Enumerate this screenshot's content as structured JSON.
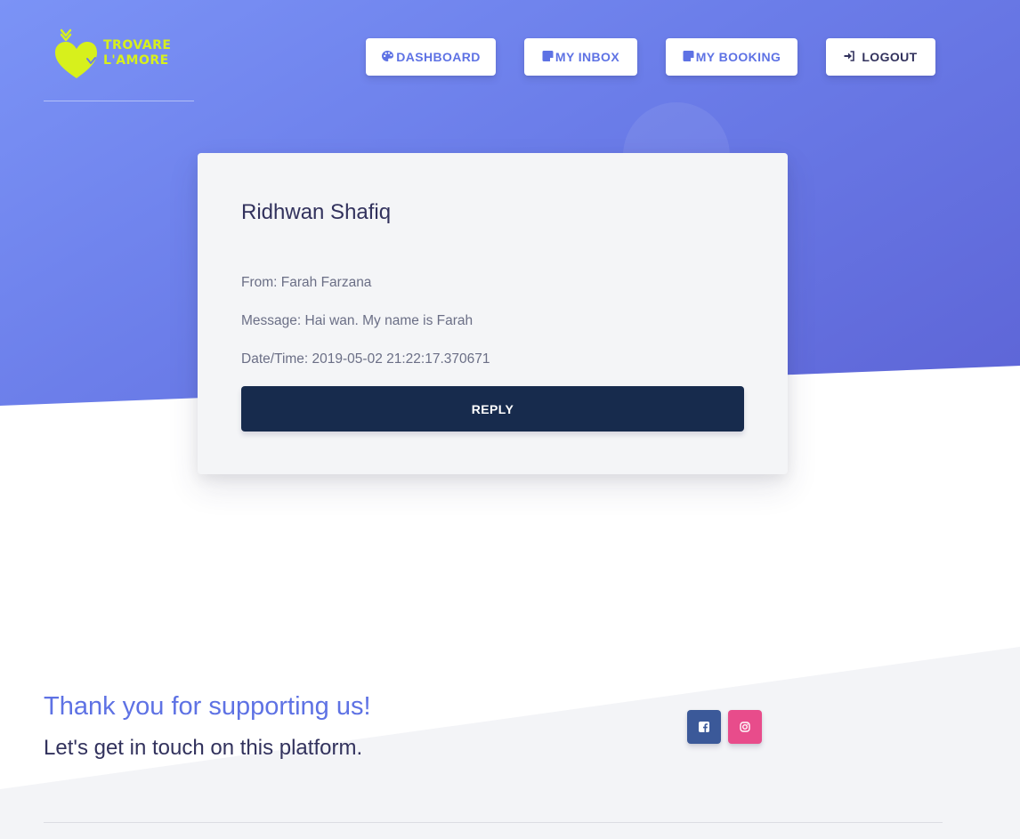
{
  "brand": {
    "logo_line1": "TROVARE",
    "logo_line2": "L'AMORE",
    "logo_color": "#d7f01c",
    "icon": "heart-logo-icon"
  },
  "nav": {
    "items": [
      {
        "label": "DASHBOARD",
        "icon": "palette-icon"
      },
      {
        "label": "MY INBOX",
        "icon": "inbox-icon"
      },
      {
        "label": "MY BOOKING",
        "icon": "booking-icon"
      },
      {
        "label": "LOGOUT",
        "icon": "sign-in-icon"
      }
    ],
    "accent": "#5e72e4"
  },
  "message_card": {
    "recipient": "Ridhwan Shafiq",
    "from": "From: Farah Farzana",
    "message": "Message: Hai wan. My name is Farah",
    "datetime": "Date/Time: 2019-05-02 21:22:17.370671",
    "reply_label": "REPLY",
    "reply_color": "#172b4d"
  },
  "footer": {
    "title": "Thank you for supporting us!",
    "subtitle": "Let's get in touch on this platform.",
    "social": [
      {
        "name": "facebook",
        "icon": "facebook-icon",
        "color": "#3b5999"
      },
      {
        "name": "instagram",
        "icon": "instagram-icon",
        "color": "#e84c8b"
      }
    ]
  },
  "colors": {
    "hero_gradient_start": "#7b93f6",
    "hero_gradient_end": "#5d64d6",
    "footer_bg": "#f3f4f7"
  }
}
